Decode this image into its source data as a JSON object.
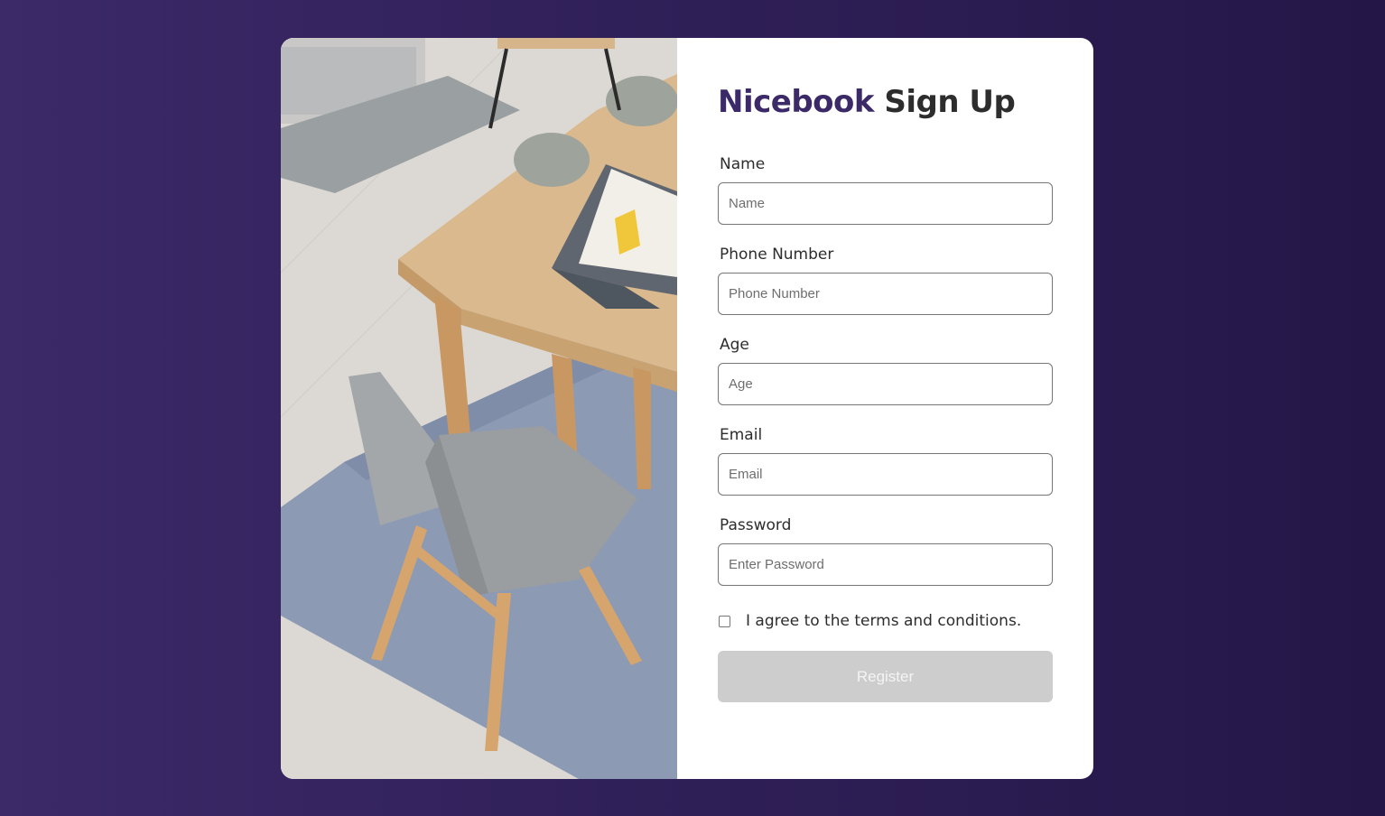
{
  "signup": {
    "title_brand": "Nicebook",
    "title_rest": "Sign Up",
    "fields": [
      {
        "label": "Name",
        "placeholder": "Name"
      },
      {
        "label": "Phone Number",
        "placeholder": "Phone Number"
      },
      {
        "label": "Age",
        "placeholder": "Age"
      },
      {
        "label": "Email",
        "placeholder": "Email"
      },
      {
        "label": "Password",
        "placeholder": "Enter Password"
      }
    ],
    "terms_label": "I agree to the terms and conditions.",
    "register_label": "Register",
    "terms_checked": false
  },
  "colors": {
    "background": "#3b2968",
    "brand": "#3b2968",
    "register_disabled": "#cdcdcd"
  },
  "image": {
    "subject": "dining-table-with-tablet-and-gray-chair-photo"
  }
}
